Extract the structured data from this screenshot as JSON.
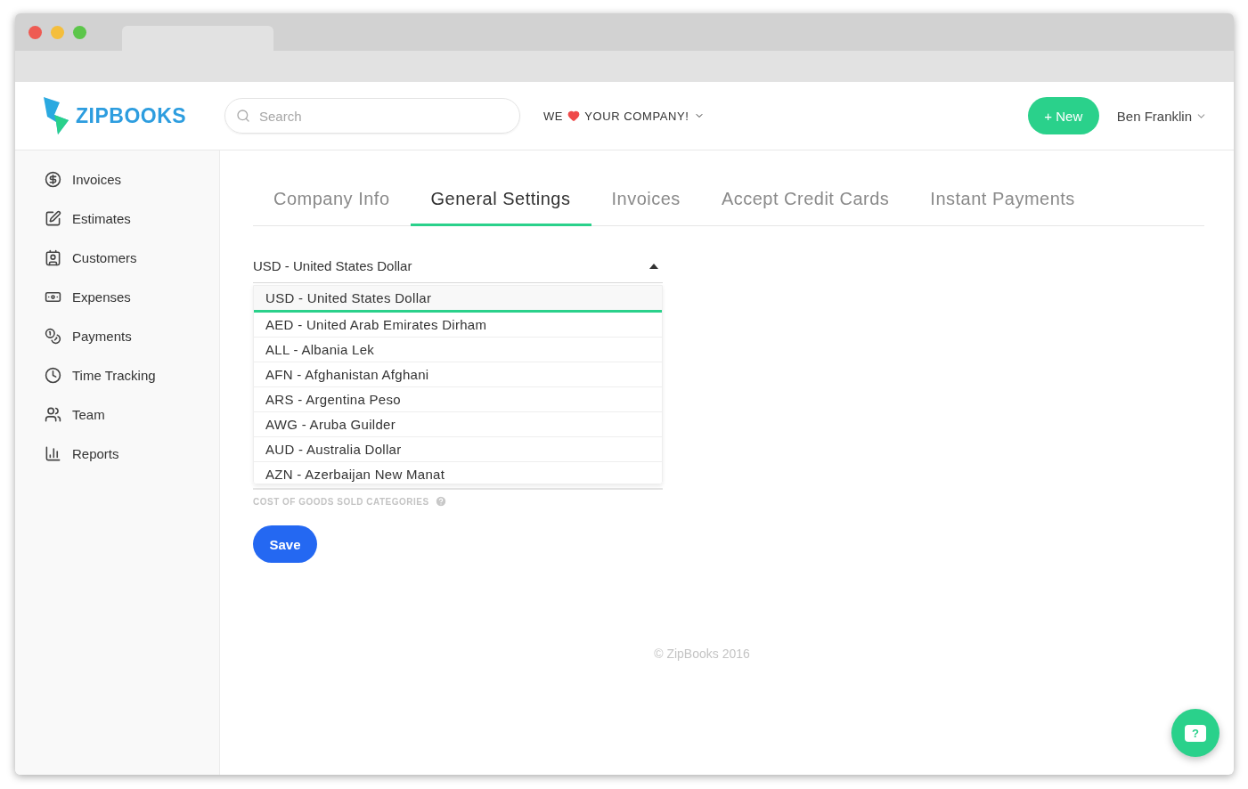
{
  "header": {
    "logo": "ZIPBOOKS",
    "search": {
      "placeholder": "Search"
    },
    "promo": {
      "before": "WE",
      "after": "YOUR COMPANY!"
    },
    "new_button": "+ New",
    "user": "Ben Franklin"
  },
  "sidebar": {
    "items": [
      {
        "label": "Invoices"
      },
      {
        "label": "Estimates"
      },
      {
        "label": "Customers"
      },
      {
        "label": "Expenses"
      },
      {
        "label": "Payments"
      },
      {
        "label": "Time Tracking"
      },
      {
        "label": "Team"
      },
      {
        "label": "Reports"
      }
    ]
  },
  "tabs": [
    {
      "label": "Company Info",
      "selected": false
    },
    {
      "label": "General Settings",
      "selected": true
    },
    {
      "label": "Invoices",
      "selected": false
    },
    {
      "label": "Accept Credit Cards",
      "selected": false
    },
    {
      "label": "Instant Payments",
      "selected": false
    }
  ],
  "currency_select": {
    "value": "USD - United States Dollar",
    "expanded": true,
    "options": [
      {
        "label": "USD - United States Dollar",
        "selected": true
      },
      {
        "label": "AED - United Arab Emirates Dirham",
        "selected": false
      },
      {
        "label": "ALL - Albania Lek",
        "selected": false
      },
      {
        "label": "AFN - Afghanistan Afghani",
        "selected": false
      },
      {
        "label": "ARS - Argentina Peso",
        "selected": false
      },
      {
        "label": "AWG - Aruba Guilder",
        "selected": false
      },
      {
        "label": "AUD - Australia Dollar",
        "selected": false
      },
      {
        "label": "AZN - Azerbaijan New Manat",
        "selected": false
      }
    ]
  },
  "cogs_label": "COST OF GOODS SOLD CATEGORIES",
  "save_button": "Save",
  "footer": "© ZipBooks 2016",
  "help_button": "?"
}
